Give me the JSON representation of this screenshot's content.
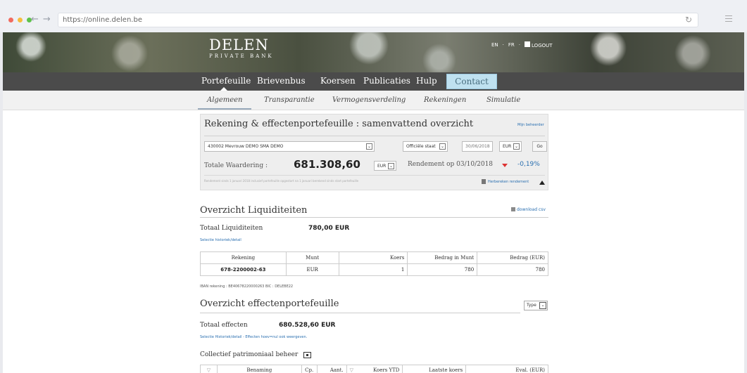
{
  "browser": {
    "url": "https://online.delen.be"
  },
  "header": {
    "logo_main": "DELEN",
    "logo_sub": "PRIVATE BANK",
    "lang_en": "EN",
    "lang_sep1": "·",
    "lang_fr": "FR",
    "lang_sep2": "·",
    "logout": "LOGOUT"
  },
  "main_nav": {
    "items": [
      "Portefeuille",
      "Brievenbus",
      "Koersen",
      "Publicaties",
      "Hulp"
    ],
    "contact": "Contact"
  },
  "sub_nav": {
    "items": [
      "Algemeen",
      "Transparantie",
      "Vermogensverdeling",
      "Rekeningen",
      "Simulatie"
    ]
  },
  "summary": {
    "title": "Rekening & effectenportefeuille : samenvattend overzicht",
    "edit_link": "Mijn beheerder",
    "account_select": "430002 Mevrouw DEMO SMA DEMO",
    "view_select": "Officiële staat",
    "date_value": "30/06/2018",
    "currency_select": "EUR",
    "go_button": "Go",
    "total_label": "Totale Waardering :",
    "total_value": "681.308,60",
    "total_currency": "EUR",
    "return_label": "Rendement op 03/10/2018",
    "return_value": "-0,19%",
    "note": "Rendement sinds 1 januari 2018 inclusief portefeuille opgestart na 1 januari berekend sinds start portefeuille",
    "recalc_link": "Herbereken rendement"
  },
  "liquidity": {
    "title": "Overzicht Liquiditeiten",
    "download": "download csv",
    "total_label": "Totaal Liquiditeiten",
    "total_value": "780,00 EUR",
    "detail_link": "Selectie historiek/detail",
    "columns": [
      "Rekening",
      "Munt",
      "Koers",
      "Bedrag in Munt",
      "Bedrag (EUR)"
    ],
    "rows": [
      [
        "678-2200002-63",
        "EUR",
        "1",
        "780",
        "780"
      ]
    ],
    "iban": "IBAN rekening : BE40678220000263 BIC : DELEBE22"
  },
  "securities": {
    "title": "Overzicht effectenportefeuille",
    "type_select": "Type",
    "total_label": "Totaal effecten",
    "total_value": "680.528,60 EUR",
    "detail_link": "Selectie Historiek/detail - Effecten hoev=nul ook weergeven.",
    "cpb_label": "Collectief patrimoniaal beheer",
    "columns": [
      "Benaming",
      "Cp.",
      "Aant.",
      "Koers YTD",
      "Laatste koers",
      "Eval. (EUR)"
    ]
  }
}
